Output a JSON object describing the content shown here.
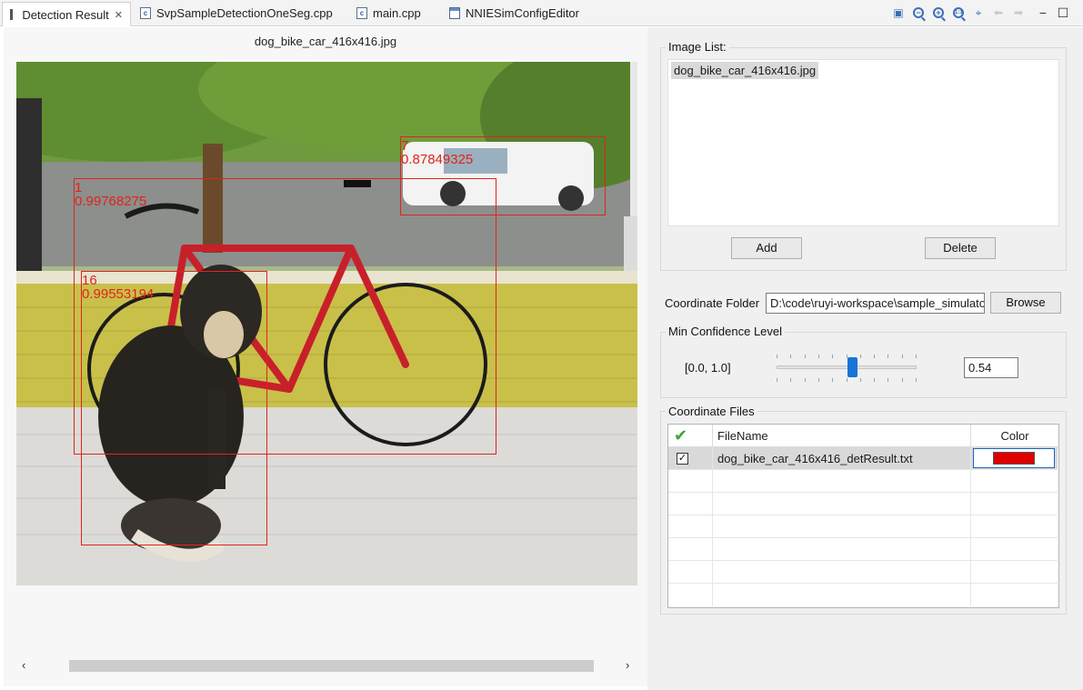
{
  "tabs": [
    {
      "label": "Detection Result",
      "icon": "view-grip-icon",
      "active": true
    },
    {
      "label": "SvpSampleDetectionOneSeg.cpp",
      "icon": "c-file-icon"
    },
    {
      "label": "main.cpp",
      "icon": "c-file-icon"
    },
    {
      "label": "NNIESimConfigEditor",
      "icon": "editor-window-icon"
    }
  ],
  "toolbar": [
    "fit-window-icon",
    "zoom-out-icon",
    "zoom-in-icon",
    "actual-size-icon",
    "select-region-icon",
    "back-arrow-icon",
    "forward-arrow-icon",
    "minimize-icon",
    "maximize-icon"
  ],
  "viewer": {
    "image_title": "dog_bike_car_416x416.jpg",
    "detections": [
      {
        "class_id": "1",
        "score": "0.99768275"
      },
      {
        "class_id": "7",
        "score": "0.87849325"
      },
      {
        "class_id": "16",
        "score": "0.99553194"
      }
    ],
    "scroll_left": "‹",
    "scroll_right": "›"
  },
  "image_list": {
    "title": "Image List:",
    "items": [
      "dog_bike_car_416x416.jpg"
    ],
    "add_label": "Add",
    "delete_label": "Delete"
  },
  "coordinate_folder": {
    "label": "Coordinate Folder",
    "value": "D:\\code\\ruyi-workspace\\sample_simulator",
    "browse_label": "Browse"
  },
  "min_confidence": {
    "title": "Min Confidence Level",
    "range_label": "[0.0, 1.0]",
    "value": "0.54",
    "level": 0.54
  },
  "coordinate_files": {
    "title": "Coordinate Files",
    "columns": {
      "check": "",
      "filename": "FileName",
      "color": "Color"
    },
    "rows": [
      {
        "checked": "✓",
        "filename": "dog_bike_car_416x416_detResult.txt",
        "color": "#e00000"
      }
    ],
    "check_header_color": "#3aa53a"
  },
  "colors": {
    "box_color": "#e0241c",
    "accent": "#1874d6"
  }
}
